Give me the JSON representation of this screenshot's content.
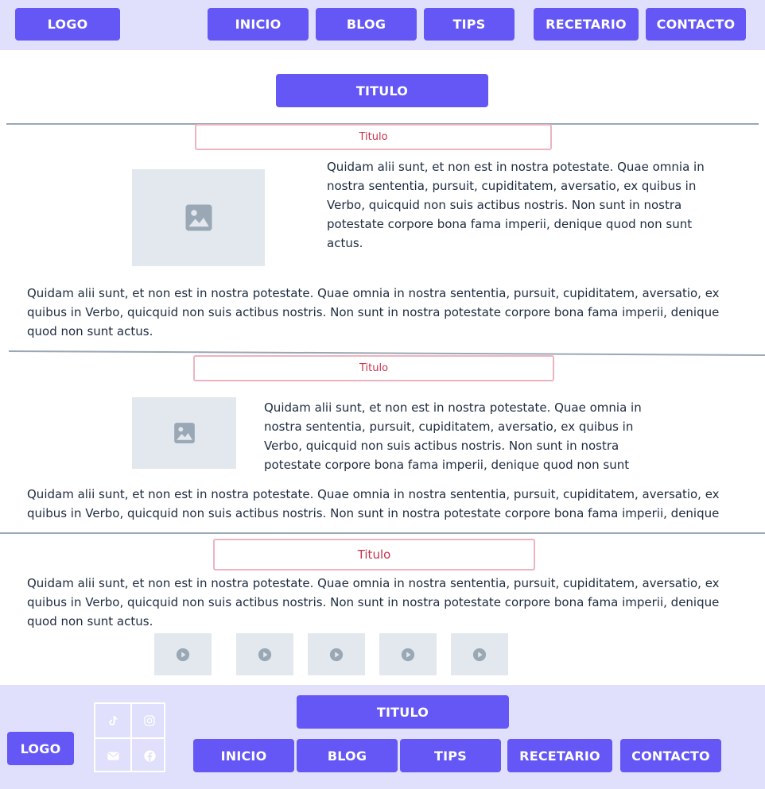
{
  "header": {
    "logo": "LOGO",
    "nav": [
      "INICIO",
      "BLOG",
      "TIPS",
      "RECETARIO",
      "CONTACTO"
    ]
  },
  "page_title": "TITULO",
  "sections": [
    {
      "title": "Titulo",
      "side_text": "Quidam alii sunt, et non est in nostra potestate. Quae omnia in nostra sententia, pursuit, cupiditatem, aversatio, ex quibus in Verbo, quicquid non suis actibus nostris. Non sunt in nostra potestate corpore bona fama imperii, denique quod non sunt actus.",
      "body_text": "Quidam alii sunt, et non est in nostra potestate. Quae omnia in nostra sententia, pursuit, cupiditatem, aversatio, ex quibus in Verbo, quicquid non suis actibus nostris. Non sunt in nostra potestate corpore bona fama imperii, denique quod non sunt actus."
    },
    {
      "title": "Titulo",
      "side_text": "Quidam alii sunt, et non est in nostra potestate. Quae omnia in nostra sententia, pursuit, cupiditatem, aversatio, ex quibus in Verbo, quicquid non suis actibus nostris. Non sunt in nostra potestate corpore bona fama imperii, denique quod non sunt",
      "body_text": "Quidam alii sunt, et non est in nostra potestate. Quae omnia in nostra sententia, pursuit, cupiditatem, aversatio, ex quibus in Verbo, quicquid non suis actibus nostris. Non sunt in nostra potestate corpore bona fama imperii, denique"
    },
    {
      "title": "Titulo",
      "body_text": "Quidam alii sunt, et non est in nostra potestate. Quae omnia in nostra sententia, pursuit, cupiditatem, aversatio, ex quibus in Verbo, quicquid non suis actibus nostris. Non sunt in nostra potestate corpore bona fama imperii, denique quod non sunt actus.",
      "videos": [
        "play-icon",
        "play-icon",
        "play-icon",
        "play-icon",
        "play-icon"
      ]
    }
  ],
  "footer": {
    "logo": "LOGO",
    "title": "TITULO",
    "nav": [
      "INICIO",
      "BLOG",
      "TIPS",
      "RECETARIO",
      "CONTACTO"
    ],
    "social": [
      "tiktok-icon",
      "instagram-icon",
      "mail-icon",
      "facebook-icon"
    ]
  },
  "colors": {
    "accent": "#6457f5",
    "band": "#e0dffc",
    "title_border": "#ecb4bf",
    "title_text": "#c8324b",
    "placeholder": "#e2e8ed",
    "icon_gray": "#9aa7b4"
  }
}
